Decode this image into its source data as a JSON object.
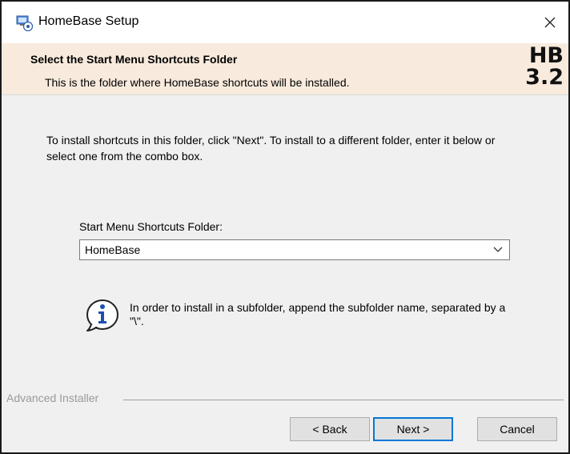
{
  "window": {
    "title": "HomeBase Setup",
    "icon": "setup-icon",
    "close_label": "✕"
  },
  "banner": {
    "title": "Select the Start Menu Shortcuts Folder",
    "subtitle": "This is the folder where HomeBase shortcuts will be installed.",
    "logo_line1": "HB",
    "logo_line2": "3.2"
  },
  "content": {
    "intro": "To install shortcuts in this folder, click \"Next\". To install to a different folder, enter it below or select one from the combo box.",
    "field_label": "Start Menu Shortcuts Folder:",
    "combo_value": "HomeBase",
    "info_text": "In order to install in a subfolder, append the subfolder name, separated by a \"\\\".",
    "info_icon": "info-icon"
  },
  "footer": {
    "brand": "Advanced Installer",
    "back_label": "< Back",
    "next_label": "Next >",
    "cancel_label": "Cancel"
  },
  "colors": {
    "banner_bg": "#f8ebdd",
    "dialog_bg": "#f0f0f0",
    "accent": "#0078d7",
    "info_blue": "#1e4fb5"
  }
}
